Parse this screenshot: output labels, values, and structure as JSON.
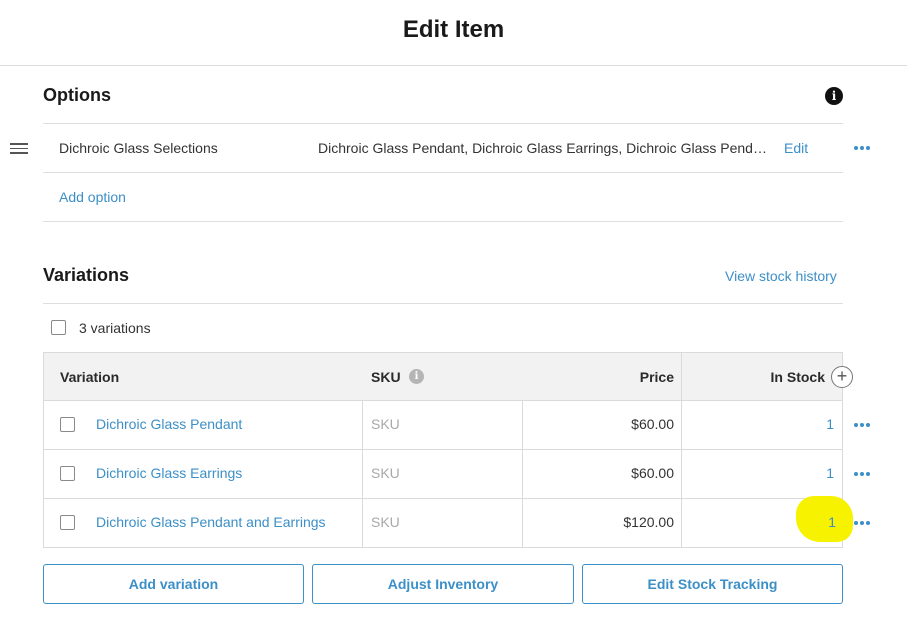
{
  "header": {
    "title": "Edit Item"
  },
  "options": {
    "title": "Options",
    "info_icon": "i",
    "option_name": "Dichroic Glass Selections",
    "option_values": "Dichroic Glass Pendant, Dichroic Glass Earrings, Dichroic Glass Pendant and Earrings",
    "edit_label": "Edit",
    "add_option_label": "Add option"
  },
  "variations": {
    "title": "Variations",
    "view_stock_history_label": "View stock history",
    "count_label": "3 variations",
    "columns": {
      "variation": "Variation",
      "sku": "SKU",
      "price": "Price",
      "in_stock": "In Stock"
    },
    "sku_info_icon": "i",
    "add_column_icon": "+",
    "rows": [
      {
        "name": "Dichroic Glass Pendant",
        "sku_placeholder": "SKU",
        "price": "$60.00",
        "in_stock": "1"
      },
      {
        "name": "Dichroic Glass Earrings",
        "sku_placeholder": "SKU",
        "price": "$60.00",
        "in_stock": "1"
      },
      {
        "name": "Dichroic Glass Pendant and Earrings",
        "sku_placeholder": "SKU",
        "price": "$120.00",
        "in_stock": "1"
      }
    ]
  },
  "actions": {
    "add_variation": "Add variation",
    "adjust_inventory": "Adjust Inventory",
    "edit_stock_tracking": "Edit Stock Tracking"
  },
  "colors": {
    "accent": "#3c8fc7",
    "highlight": "#f7f200",
    "header_bg": "#f2f2f2"
  },
  "icons": [
    "drag-handle-icon",
    "info-icon",
    "more-icon",
    "plus-circle-icon",
    "checkbox-icon"
  ]
}
